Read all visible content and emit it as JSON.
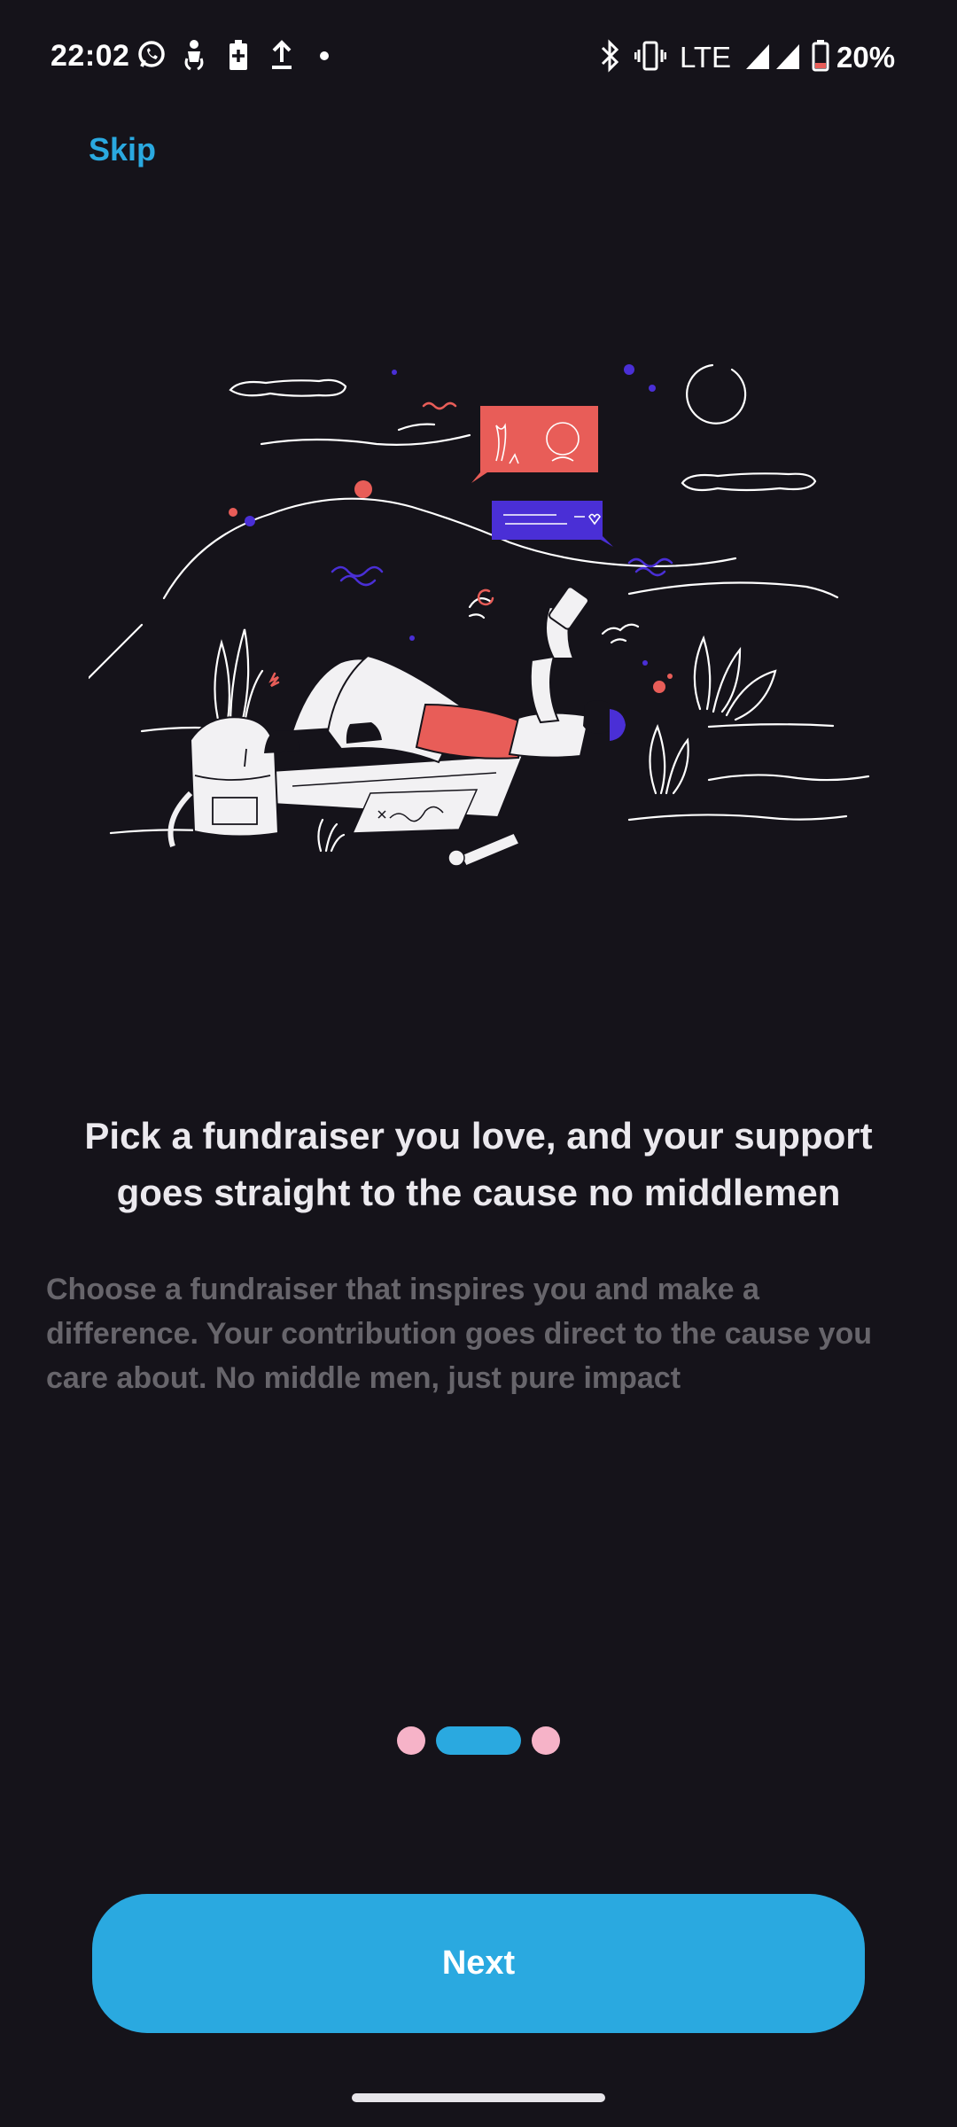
{
  "status_bar": {
    "time": "22:02",
    "network": "LTE",
    "battery_percent": "20%",
    "left_icons": [
      "whatsapp-icon",
      "person-icon",
      "battery-saver-icon",
      "upload-icon",
      "dot-icon"
    ],
    "right_icons": [
      "bluetooth-icon",
      "vibrate-icon",
      "signal-icon",
      "signal-icon",
      "battery-icon"
    ]
  },
  "skip_label": "Skip",
  "headline": "Pick a fundraiser you love, and your support goes straight to the cause no middlemen",
  "body": "Choose a fundraiser that inspires you and make a difference. Your contribution goes direct to the cause you care about. No middle men, just pure impact",
  "pager": {
    "total": 3,
    "active_index": 1
  },
  "next_label": "Next",
  "colors": {
    "background": "#15131a",
    "accent": "#2aa9e0",
    "dot_inactive": "#f6b3c8",
    "coral": "#e85d58",
    "purple": "#4a2fd6"
  }
}
